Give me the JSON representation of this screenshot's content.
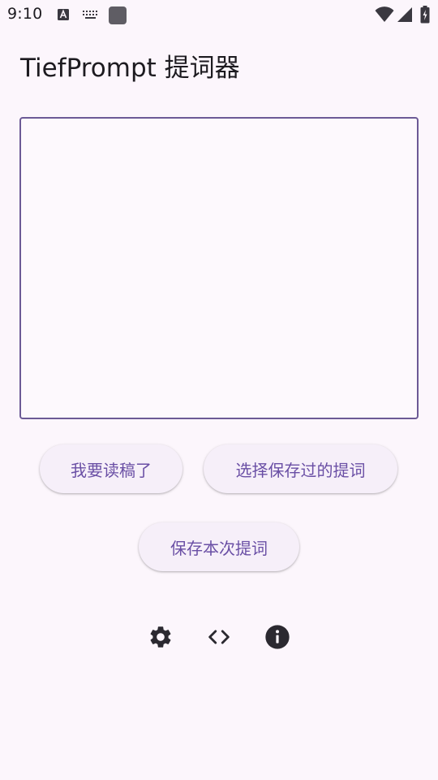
{
  "status_bar": {
    "time": "9:10",
    "icons": [
      "a-box-icon",
      "keyboard-icon",
      "square-notification-icon",
      "wifi-icon",
      "cell-signal-icon",
      "battery-charging-icon"
    ]
  },
  "app": {
    "title": "TiefPrompt 提词器"
  },
  "editor": {
    "value": "",
    "placeholder": ""
  },
  "buttons": {
    "read_label": "我要读稿了",
    "select_label": "选择保存过的提词",
    "save_label": "保存本次提词"
  },
  "bottom_icons": [
    "gear-icon",
    "code-icon",
    "info-icon"
  ],
  "colors": {
    "background": "#fcf6fc",
    "accent": "#6c5a96",
    "button_bg": "#f6eff9",
    "button_text": "#6a4fa5",
    "icon": "#2b2930"
  }
}
